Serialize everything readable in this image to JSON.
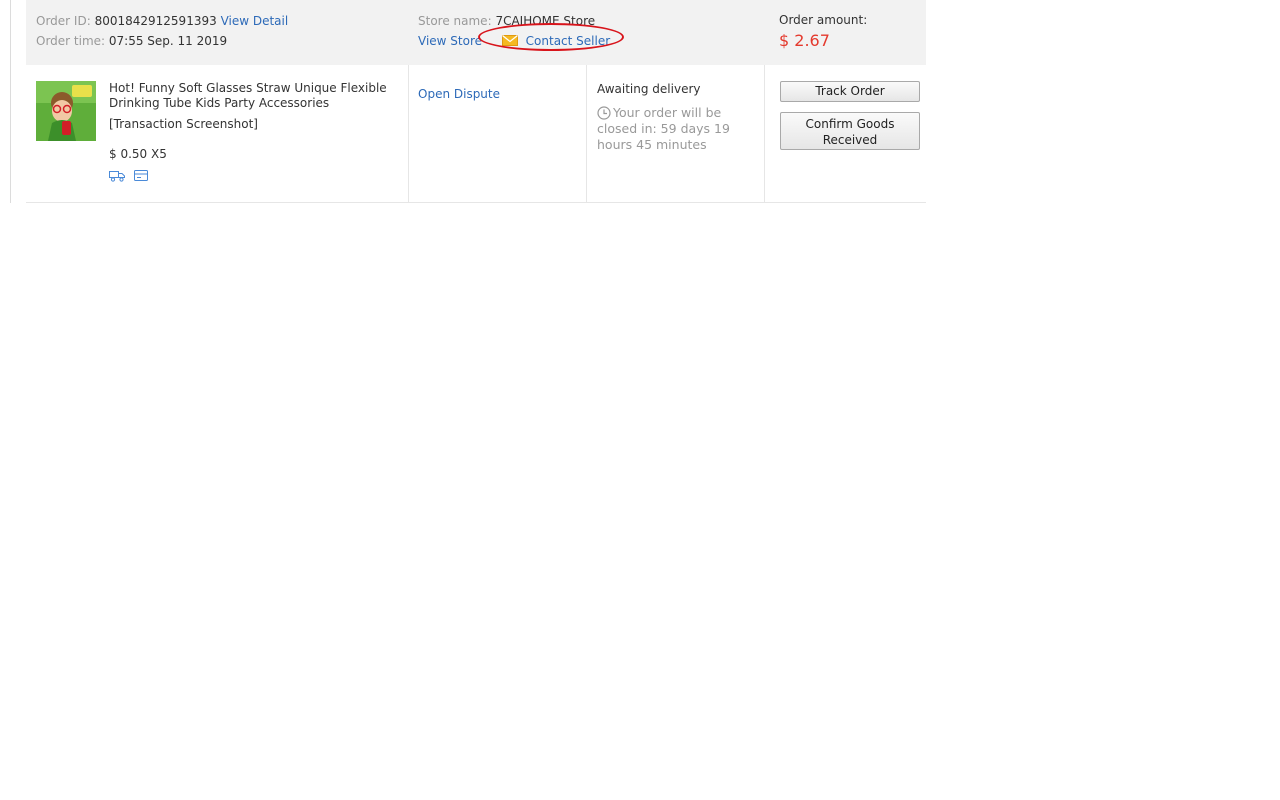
{
  "header": {
    "order_id_label": "Order ID:",
    "order_id": "8001842912591393",
    "view_detail": "View Detail",
    "order_time_label": "Order time:",
    "order_time": "07:55 Sep. 11 2019",
    "store_name_label": "Store name:",
    "store_name": "7CAIHOME Store",
    "view_store": "View Store",
    "contact_seller": "Contact Seller",
    "amount_label": "Order amount:",
    "amount": "$ 2.67"
  },
  "item": {
    "title": "Hot! Funny Soft Glasses Straw Unique Flexible Drinking Tube Kids Party Accessories",
    "transaction_screenshot": "[Transaction Screenshot]",
    "price_qty": "$ 0.50 X5",
    "service_icons": [
      "delivery-truck-icon",
      "card-icon"
    ]
  },
  "actions": {
    "open_dispute": "Open Dispute",
    "status": "Awaiting delivery",
    "countdown": "Your order will be closed in: 59 days 19 hours 45 minutes",
    "track_order": "Track Order",
    "confirm_goods": "Confirm Goods Received"
  },
  "colors": {
    "link": "#2d6ab8",
    "amount": "#e4392d",
    "annotation": "#d8141b",
    "header_bg": "#f2f2f2"
  },
  "annotation": {
    "shape": "hand-drawn red circle around Contact Seller"
  }
}
